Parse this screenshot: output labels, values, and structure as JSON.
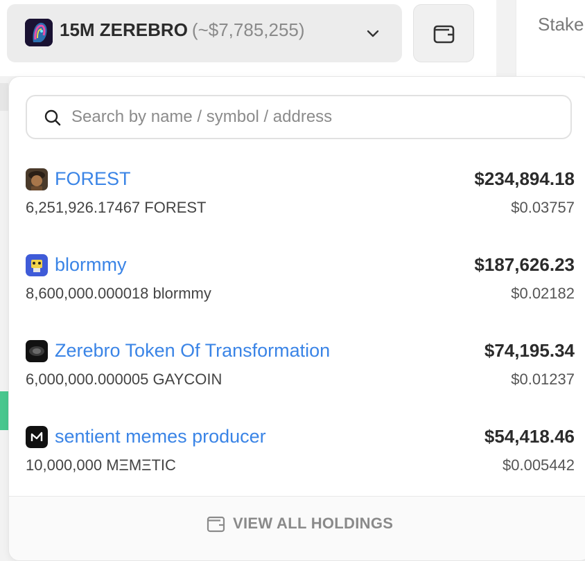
{
  "header": {
    "token_amount": "15M ZEREBRO",
    "token_usd": "(~$7,785,255)",
    "right_tab_label": "Stake"
  },
  "search": {
    "placeholder": "Search by name / symbol / address",
    "value": ""
  },
  "holdings": [
    {
      "name": "FOREST",
      "quantity": "6,251,926.17467 FOREST",
      "value": "$234,894.18",
      "price": "$0.03757",
      "icon": "forest-token-icon"
    },
    {
      "name": "blormmy",
      "quantity": "8,600,000.000018 blormmy",
      "value": "$187,626.23",
      "price": "$0.02182",
      "icon": "blormmy-token-icon"
    },
    {
      "name": "Zerebro Token Of Transformation",
      "quantity": "6,000,000.000005 GAYCOIN",
      "value": "$74,195.34",
      "price": "$0.01237",
      "icon": "gaycoin-token-icon"
    },
    {
      "name": "sentient memes producer",
      "quantity": "10,000,000 MΞMΞTIC",
      "value": "$54,418.46",
      "price": "$0.005442",
      "icon": "memetic-token-icon"
    }
  ],
  "footer": {
    "view_all_label": "VIEW ALL HOLDINGS"
  },
  "colors": {
    "link": "#3a84e6",
    "selector_bg": "#ececec",
    "muted": "#8a8a8a"
  }
}
